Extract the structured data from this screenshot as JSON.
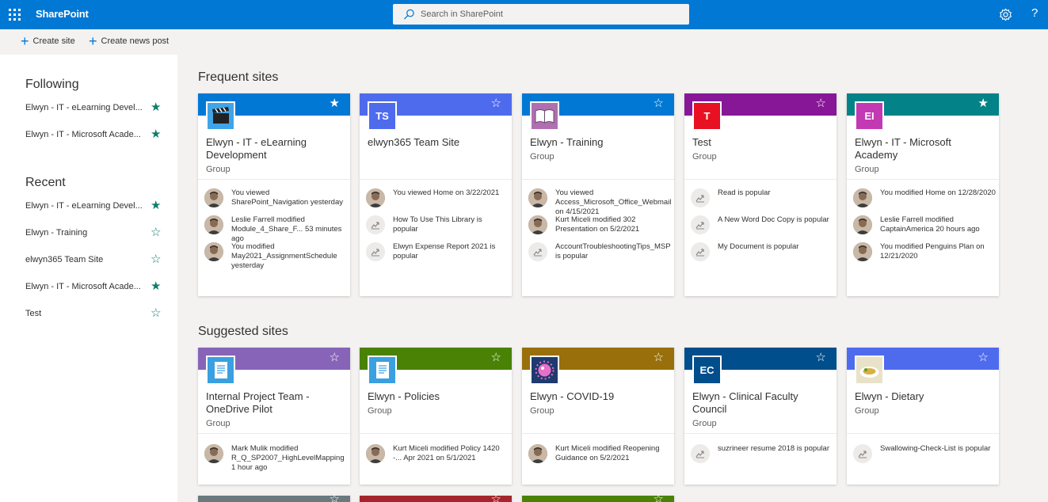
{
  "app": {
    "name": "SharePoint",
    "search_placeholder": "Search in SharePoint"
  },
  "commands": {
    "create_site": "Create site",
    "create_news": "Create news post"
  },
  "nav": {
    "following_heading": "Following",
    "following": [
      {
        "label": "Elwyn - IT - eLearning Devel...",
        "starred": true
      },
      {
        "label": "Elwyn - IT - Microsoft Acade...",
        "starred": true
      }
    ],
    "recent_heading": "Recent",
    "recent": [
      {
        "label": "Elwyn - IT - eLearning Devel...",
        "starred": true
      },
      {
        "label": "Elwyn - Training",
        "starred": false
      },
      {
        "label": "elwyn365 Team Site",
        "starred": false
      },
      {
        "label": "Elwyn - IT - Microsoft Acade...",
        "starred": true
      },
      {
        "label": "Test",
        "starred": false
      }
    ]
  },
  "frequent_heading": "Frequent sites",
  "suggested_heading": "Suggested sites",
  "frequent": [
    {
      "title": "Elwyn - IT - eLearning Development",
      "sub": "Group",
      "color": "#0078d4",
      "logo": "clapper-icon",
      "starred": true,
      "acts": [
        {
          "text": "You viewed SharePoint_Navigation yesterday",
          "avatar": "person"
        },
        {
          "text": "Leslie Farrell modified Module_4_Share_F... 53 minutes ago",
          "avatar": "person"
        },
        {
          "text": "You modified May2021_AssignmentSchedule yesterday",
          "avatar": "person"
        }
      ]
    },
    {
      "title": "elwyn365 Team Site",
      "sub": "",
      "color": "#4f6bed",
      "logo_text": "TS",
      "logo_color": "#4f6bed",
      "starred": false,
      "acts": [
        {
          "text": "You viewed Home on 3/22/2021",
          "avatar": "person"
        },
        {
          "text": "How To Use This Library is popular",
          "avatar": "trend"
        },
        {
          "text": "Elwyn Expense Report 2021 is popular",
          "avatar": "trend"
        }
      ]
    },
    {
      "title": "Elwyn - Training",
      "sub": "Group",
      "color": "#0078d4",
      "logo": "book-icon",
      "starred": false,
      "acts": [
        {
          "text": "You viewed Access_Microsoft_Office_Webmail on 4/15/2021",
          "avatar": "person"
        },
        {
          "text": "Kurt Miceli modified 302 Presentation on 5/2/2021",
          "avatar": "person"
        },
        {
          "text": "AccountTroubleshootingTips_MSP is popular",
          "avatar": "trend"
        }
      ]
    },
    {
      "title": "Test",
      "sub": "Group",
      "color": "#881798",
      "logo_text": "T",
      "logo_color": "#e81123",
      "starred": false,
      "acts": [
        {
          "text": "Read is popular",
          "avatar": "trend"
        },
        {
          "text": "A New Word Doc Copy is popular",
          "avatar": "trend"
        },
        {
          "text": "My Document is popular",
          "avatar": "trend"
        }
      ]
    },
    {
      "title": "Elwyn - IT - Microsoft Academy",
      "sub": "Group",
      "color": "#038387",
      "logo_text": "EI",
      "logo_color": "#c239b3",
      "starred": true,
      "acts": [
        {
          "text": "You modified Home on 12/28/2020",
          "avatar": "person"
        },
        {
          "text": "Leslie Farrell modified CaptainAmerica 20 hours ago",
          "avatar": "person"
        },
        {
          "text": "You modified Penguins Plan on 12/21/2020",
          "avatar": "person"
        }
      ]
    }
  ],
  "suggested": [
    {
      "title": "Internal Project Team - OneDrive Pilot",
      "sub": "Group",
      "color": "#8764b8",
      "logo": "document-icon",
      "starred": false,
      "acts": [
        {
          "text": "Mark Mulik modified R_Q_SP2007_HighLevelMapping 1 hour ago",
          "avatar": "person"
        }
      ]
    },
    {
      "title": "Elwyn - Policies",
      "sub": "Group",
      "color": "#498205",
      "logo": "document-icon",
      "starred": false,
      "acts": [
        {
          "text": "Kurt Miceli modified Policy 1420 -... Apr 2021 on 5/1/2021",
          "avatar": "person"
        }
      ]
    },
    {
      "title": "Elwyn - COVID-19",
      "sub": "Group",
      "color": "#986f0b",
      "logo": "virus-icon",
      "starred": false,
      "acts": [
        {
          "text": "Kurt Miceli modified Reopening Guidance on 5/2/2021",
          "avatar": "person"
        }
      ]
    },
    {
      "title": "Elwyn - Clinical Faculty Council",
      "sub": "Group",
      "color": "#004e8c",
      "logo_text": "EC",
      "logo_color": "#004e8c",
      "starred": false,
      "acts": [
        {
          "text": "suzrineer resume 2018 is popular",
          "avatar": "trend"
        }
      ]
    },
    {
      "title": "Elwyn - Dietary",
      "sub": "Group",
      "color": "#4f6bed",
      "logo": "food-icon",
      "starred": false,
      "acts": [
        {
          "text": "Swallowing-Check-List is popular",
          "avatar": "trend"
        }
      ]
    }
  ],
  "third_row_colors": [
    "#69797e",
    "#a4262c",
    "#498205"
  ]
}
